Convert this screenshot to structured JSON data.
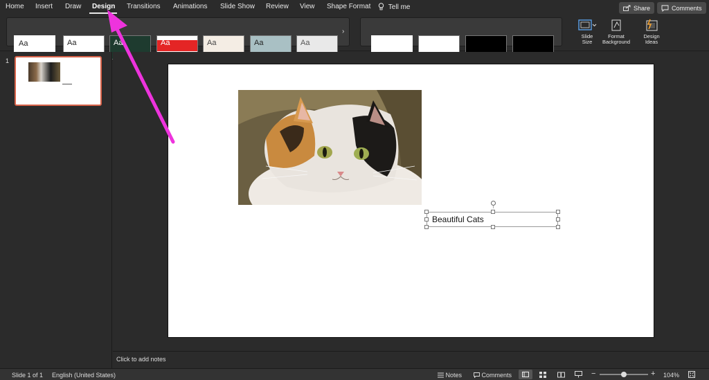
{
  "tabs": [
    "Home",
    "Insert",
    "Draw",
    "Design",
    "Transitions",
    "Animations",
    "Slide Show",
    "Review",
    "View",
    "Shape Format"
  ],
  "active_tab": "Design",
  "tell_me": "Tell me",
  "share_label": "Share",
  "comments_label": "Comments",
  "themes": [
    {
      "label": "Aa",
      "bg": "#ffffff",
      "fg": "#222222",
      "colors": [
        "#4472c4",
        "#ed7d31",
        "#a5a5a5",
        "#ffc000",
        "#5b9bd5",
        "#70ad47"
      ]
    },
    {
      "label": "Aa",
      "bg": "#ffffff",
      "fg": "#222222",
      "colors": [
        "#4472c4",
        "#ed7d31",
        "#a5a5a5",
        "#ffc000",
        "#5b9bd5",
        "#70ad47"
      ]
    },
    {
      "label": "Aa",
      "bg": "#1e3b2f",
      "fg": "#ffffff",
      "colors": [
        "#a9d18e",
        "#f4b183",
        "#9dc3e6",
        "#ffd966",
        "#c9c9c9",
        "#8faadc"
      ]
    },
    {
      "label": "Aa",
      "bg": "#ffffff",
      "fg": "#ffffff",
      "colors": [
        "#e42525",
        "#f4a300",
        "#ffd400",
        "#6ab04c",
        "#4fa3d1",
        "#7a4fb0"
      ]
    },
    {
      "label": "Aa",
      "bg": "#f4ede4",
      "fg": "#444444",
      "colors": [
        "#d36c4f",
        "#c8a95a",
        "#7b9c6a",
        "#6b8fb0",
        "#9a7bb0",
        "#b07b6a"
      ]
    },
    {
      "label": "Aa",
      "bg": "#a9c0c4",
      "fg": "#222222",
      "colors": [
        "#e0a41a",
        "#5c7e8b",
        "#3f6b73",
        "#c86f2c",
        "#8aa95a",
        "#6b6b6b"
      ]
    },
    {
      "label": "Aa",
      "bg": "#e9e9e9",
      "fg": "#555555",
      "colors": [
        "#a33b2b",
        "#6b6b6b",
        "#4f7fa0",
        "#9c6b3a",
        "#5e8a4f",
        "#7b5ea0"
      ]
    }
  ],
  "variants": [
    {
      "bg": "#ffffff",
      "colors": [
        "#4472c4",
        "#ed7d31",
        "#a5a5a5",
        "#ffc000",
        "#5b9bd5",
        "#70ad47"
      ]
    },
    {
      "bg": "#ffffff",
      "colors": [
        "#4472c4",
        "#ed7d31",
        "#a5a5a5",
        "#ffc000",
        "#5b9bd5",
        "#70ad47"
      ]
    },
    {
      "bg": "#000000",
      "colors": [
        "#4472c4",
        "#ed7d31",
        "#a5a5a5",
        "#ffc000",
        "#5b9bd5",
        "#70ad47"
      ]
    },
    {
      "bg": "#000000",
      "colors": [
        "#4472c4",
        "#ed7d31",
        "#a5a5a5",
        "#ffc000",
        "#5b9bd5",
        "#70ad47"
      ]
    }
  ],
  "ribbon_buttons": {
    "slide_size": [
      "Slide",
      "Size"
    ],
    "format_background": [
      "Format",
      "Background"
    ],
    "design_ideas": [
      "Design",
      "Ideas"
    ]
  },
  "slide_number": "1",
  "textbox_text": "Beautiful Cats",
  "notes_placeholder": "Click to add notes",
  "status": {
    "slide_info": "Slide 1 of 1",
    "language": "English (United States)",
    "notes": "Notes",
    "comments": "Comments",
    "zoom": "104%"
  },
  "colors": {
    "accent": "#d9634a",
    "annotation_arrow": "#ee33dd"
  }
}
